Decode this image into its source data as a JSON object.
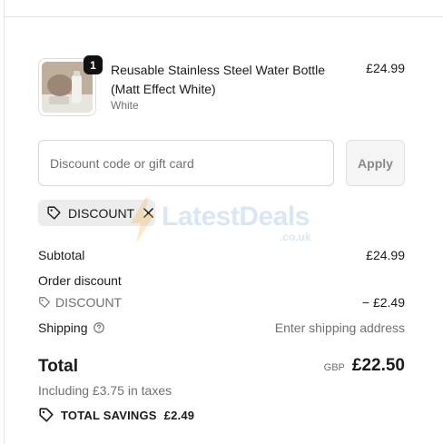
{
  "product": {
    "quantity": "1",
    "name": "Reusable Stainless Steel Water Bottle (Matt Effect White)",
    "variant": "White",
    "price": "£24.99",
    "image_icon": "product-thumbnail"
  },
  "discount_form": {
    "placeholder": "Discount code or gift card",
    "value": "",
    "apply_label": "Apply"
  },
  "applied_discount": {
    "code": "DISCOUNT",
    "tag_icon": "tag-icon",
    "remove_icon": "close-icon"
  },
  "watermark": {
    "text": "LatestDeals",
    "subtext": ".co.uk"
  },
  "summary": {
    "subtotal_label": "Subtotal",
    "subtotal_value": "£24.99",
    "order_discount_label": "Order discount",
    "discount_code": "DISCOUNT",
    "discount_value": "− £2.49",
    "shipping_label": "Shipping",
    "shipping_value": "Enter shipping address",
    "total_label": "Total",
    "currency": "GBP",
    "total_value": "£22.50",
    "taxes_note": "Including £3.75 in taxes",
    "savings_label": "TOTAL SAVINGS",
    "savings_value": "£2.49"
  },
  "colors": {
    "text": "#1a1a1a",
    "muted": "#707070",
    "tag_bg": "#ececec",
    "badge_bg": "#111111",
    "apply_bg": "#f5f5f5"
  }
}
